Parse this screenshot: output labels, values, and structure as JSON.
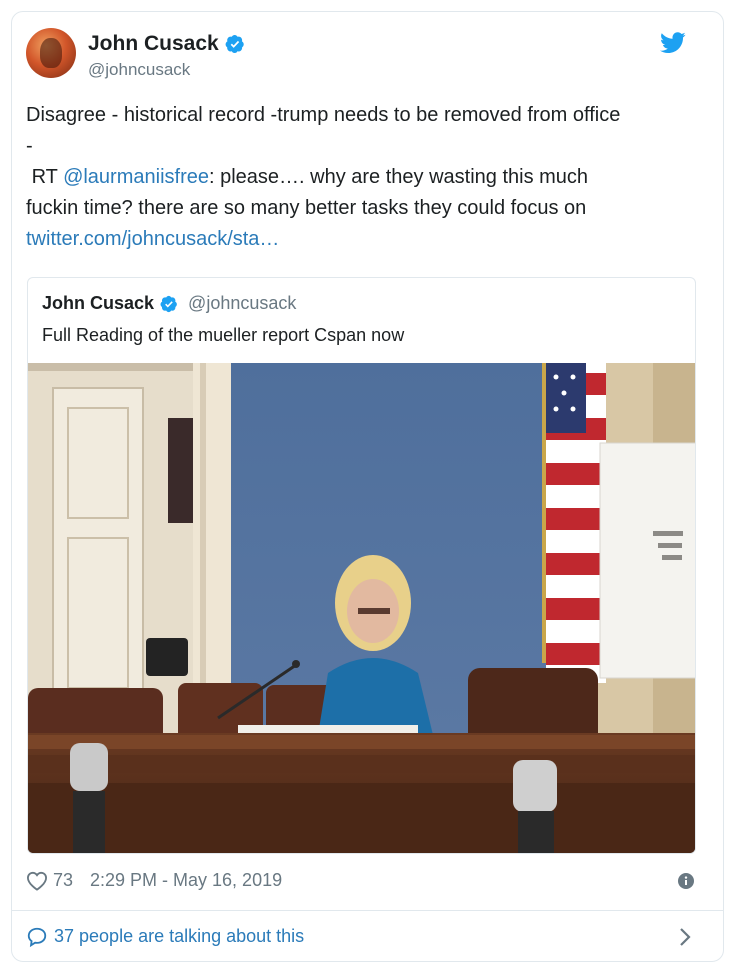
{
  "author": {
    "name": "John Cusack",
    "handle": "@johncusack"
  },
  "tweet": {
    "line1": "Disagree - historical record -trump needs to be removed from office",
    "line2": "-",
    "rt_prefix": "RT ",
    "mention": "@laurmaniisfree",
    "rt_rest": ": please…. why are they wasting this much",
    "line4": "fuckin time? there are so many better tasks they could focus on",
    "link": "twitter.com/johncusack/sta…"
  },
  "quoted": {
    "name": "John Cusack",
    "handle": "@johncusack",
    "text": "Full Reading of the mueller report Cspan now"
  },
  "stats": {
    "likes": "73",
    "timestamp": "2:29 PM - May 16, 2019"
  },
  "conversation": {
    "label": "37 people are talking about this"
  },
  "colors": {
    "link": "#2b7bb9",
    "verified": "#1da1f2",
    "muted": "#697882"
  }
}
